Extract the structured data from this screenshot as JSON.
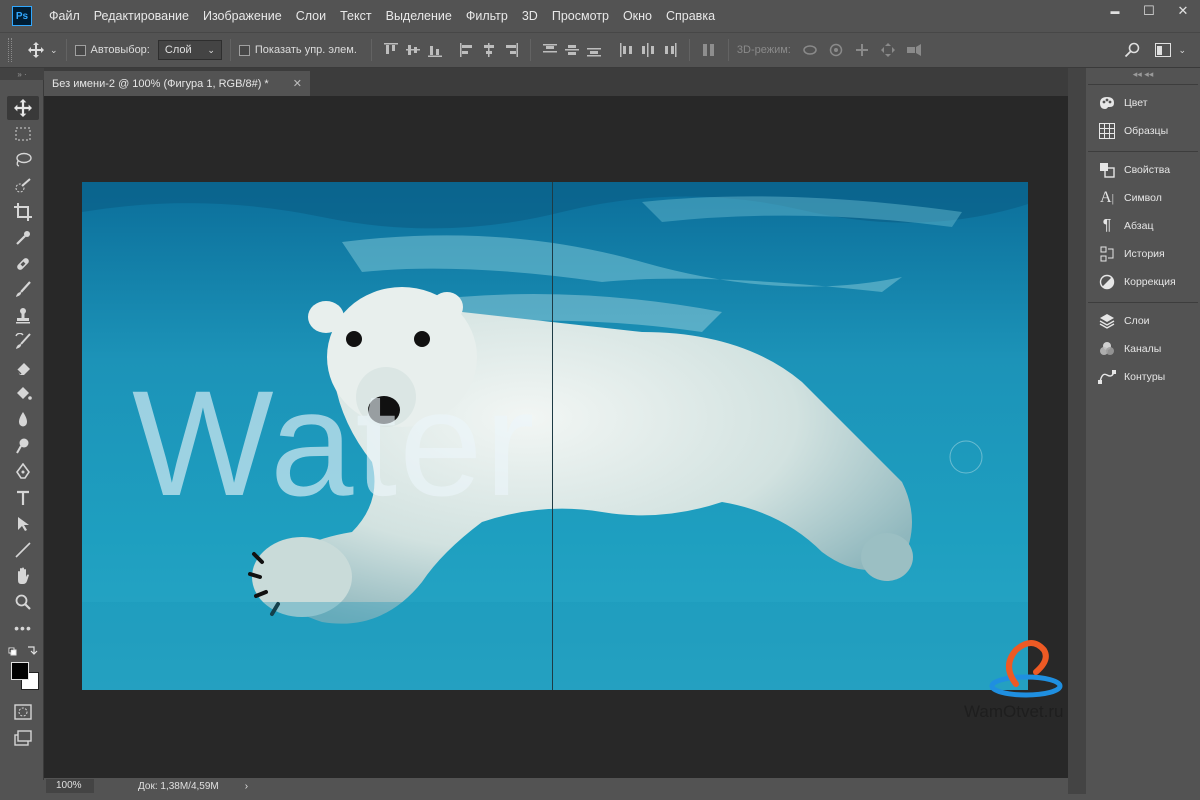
{
  "app": {
    "logo": "Ps"
  },
  "menu": [
    "Файл",
    "Редактирование",
    "Изображение",
    "Слои",
    "Текст",
    "Выделение",
    "Фильтр",
    "3D",
    "Просмотр",
    "Окно",
    "Справка"
  ],
  "window_controls": {
    "minimize": "▬",
    "maximize": "☐",
    "close": "✕"
  },
  "options": {
    "autoselect_label": "Автовыбор:",
    "autoselect_value": "Слой",
    "show_transform_label": "Показать упр. элем.",
    "mode_3d_label": "3D-режим:"
  },
  "document": {
    "tab_title": "Без имени-2 @ 100% (Фигура 1, RGB/8#) *",
    "close_glyph": "✕",
    "canvas_text": "Water",
    "zoom": "100%",
    "doc_info": "Док: 1,38M/4,59M",
    "status_arrow": "›"
  },
  "panels": {
    "group1": [
      {
        "label": "Цвет",
        "icon": "palette-icon"
      },
      {
        "label": "Образцы",
        "icon": "swatches-grid-icon"
      }
    ],
    "group2": [
      {
        "label": "Свойства",
        "icon": "properties-icon"
      },
      {
        "label": "Символ",
        "icon": "character-icon"
      },
      {
        "label": "Абзац",
        "icon": "paragraph-icon"
      },
      {
        "label": "История",
        "icon": "history-icon"
      },
      {
        "label": "Коррекция",
        "icon": "adjustments-icon"
      }
    ],
    "group3": [
      {
        "label": "Слои",
        "icon": "layers-icon"
      },
      {
        "label": "Каналы",
        "icon": "channels-icon"
      },
      {
        "label": "Контуры",
        "icon": "paths-icon"
      }
    ]
  },
  "watermark": {
    "text": "WamOtvet.ru"
  },
  "colors": {
    "accent": "#31a8ff",
    "canvas_bg": "#1a8fb0",
    "ui_bg": "#535353"
  }
}
